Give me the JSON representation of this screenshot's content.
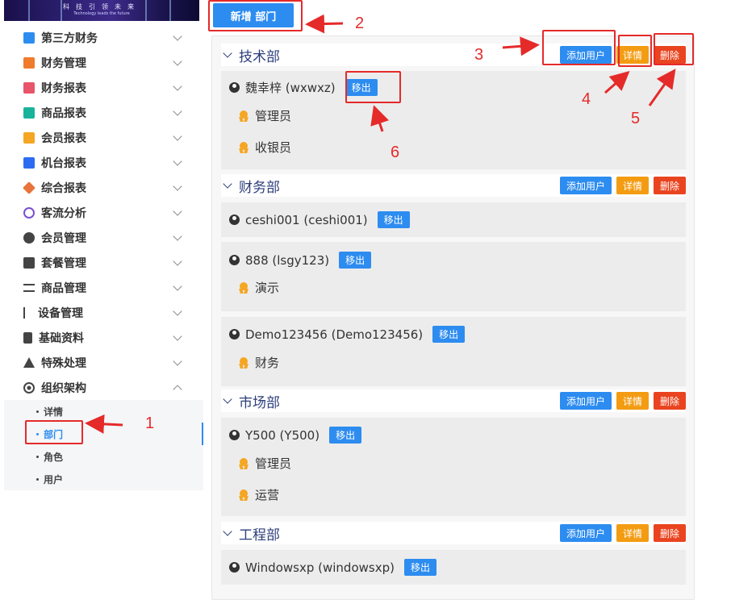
{
  "banner": {
    "line1": "科技引领未来",
    "line2": "Technology leads the future"
  },
  "sidebar": {
    "items": [
      {
        "label": "第三方财务",
        "icon": "calculator-icon",
        "color": "#2d8cf0"
      },
      {
        "label": "财务管理",
        "icon": "ledger-icon",
        "color": "#f07b2d"
      },
      {
        "label": "财务报表",
        "icon": "report-icon",
        "color": "#e8546a"
      },
      {
        "label": "商品报表",
        "icon": "goods-report-icon",
        "color": "#19b39b"
      },
      {
        "label": "会员报表",
        "icon": "member-report-icon",
        "color": "#f5a623"
      },
      {
        "label": "机台报表",
        "icon": "machine-report-icon",
        "color": "#2d6cf0"
      },
      {
        "label": "综合报表",
        "icon": "layers-icon",
        "color": "#e8743b"
      },
      {
        "label": "客流分析",
        "icon": "target-icon",
        "color": "#7b4fd6"
      },
      {
        "label": "会员管理",
        "icon": "user-circle-icon",
        "color": "#444444"
      },
      {
        "label": "套餐管理",
        "icon": "edit-icon",
        "color": "#444444"
      },
      {
        "label": "商品管理",
        "icon": "exchange-icon",
        "color": "#444444"
      },
      {
        "label": "设备管理",
        "icon": "git-branch-icon",
        "color": "#444444"
      },
      {
        "label": "基础资料",
        "icon": "document-icon",
        "color": "#444444"
      },
      {
        "label": "特殊处理",
        "icon": "warning-icon",
        "color": "#444444"
      },
      {
        "label": "组织架构",
        "icon": "radio-dot-icon",
        "color": "#444444"
      }
    ],
    "submenu": [
      {
        "label": "详情"
      },
      {
        "label": "部门",
        "active": true
      },
      {
        "label": "角色"
      },
      {
        "label": "用户"
      }
    ]
  },
  "toolbar": {
    "add_dept_label": "新增 部门"
  },
  "actions": {
    "add_user": "添加用户",
    "detail": "详情",
    "delete": "删除",
    "remove": "移出"
  },
  "departments": [
    {
      "name": "技术部",
      "users": [
        {
          "name": "魏幸梓 (wxwxz)",
          "roles": [
            "管理员",
            "收银员"
          ]
        }
      ]
    },
    {
      "name": "财务部",
      "users": [
        {
          "name": "ceshi001 (ceshi001)",
          "roles": []
        },
        {
          "name": "888 (lsgy123)",
          "roles": [
            "演示"
          ]
        },
        {
          "name": "Demo123456 (Demo123456)",
          "roles": [
            "财务"
          ]
        }
      ]
    },
    {
      "name": "市场部",
      "users": [
        {
          "name": "Y500 (Y500)",
          "roles": [
            "管理员",
            "运营"
          ]
        }
      ]
    },
    {
      "name": "工程部",
      "users": [
        {
          "name": "Windowsxp (windowsxp)",
          "roles": []
        }
      ]
    }
  ],
  "annotations": {
    "n1": "1",
    "n2": "2",
    "n3": "3",
    "n4": "4",
    "n5": "5",
    "n6": "6"
  },
  "colors": {
    "primary": "#2d8cf0",
    "warning": "#f39c12",
    "danger": "#e9441f",
    "annotation": "#e52a2a"
  }
}
